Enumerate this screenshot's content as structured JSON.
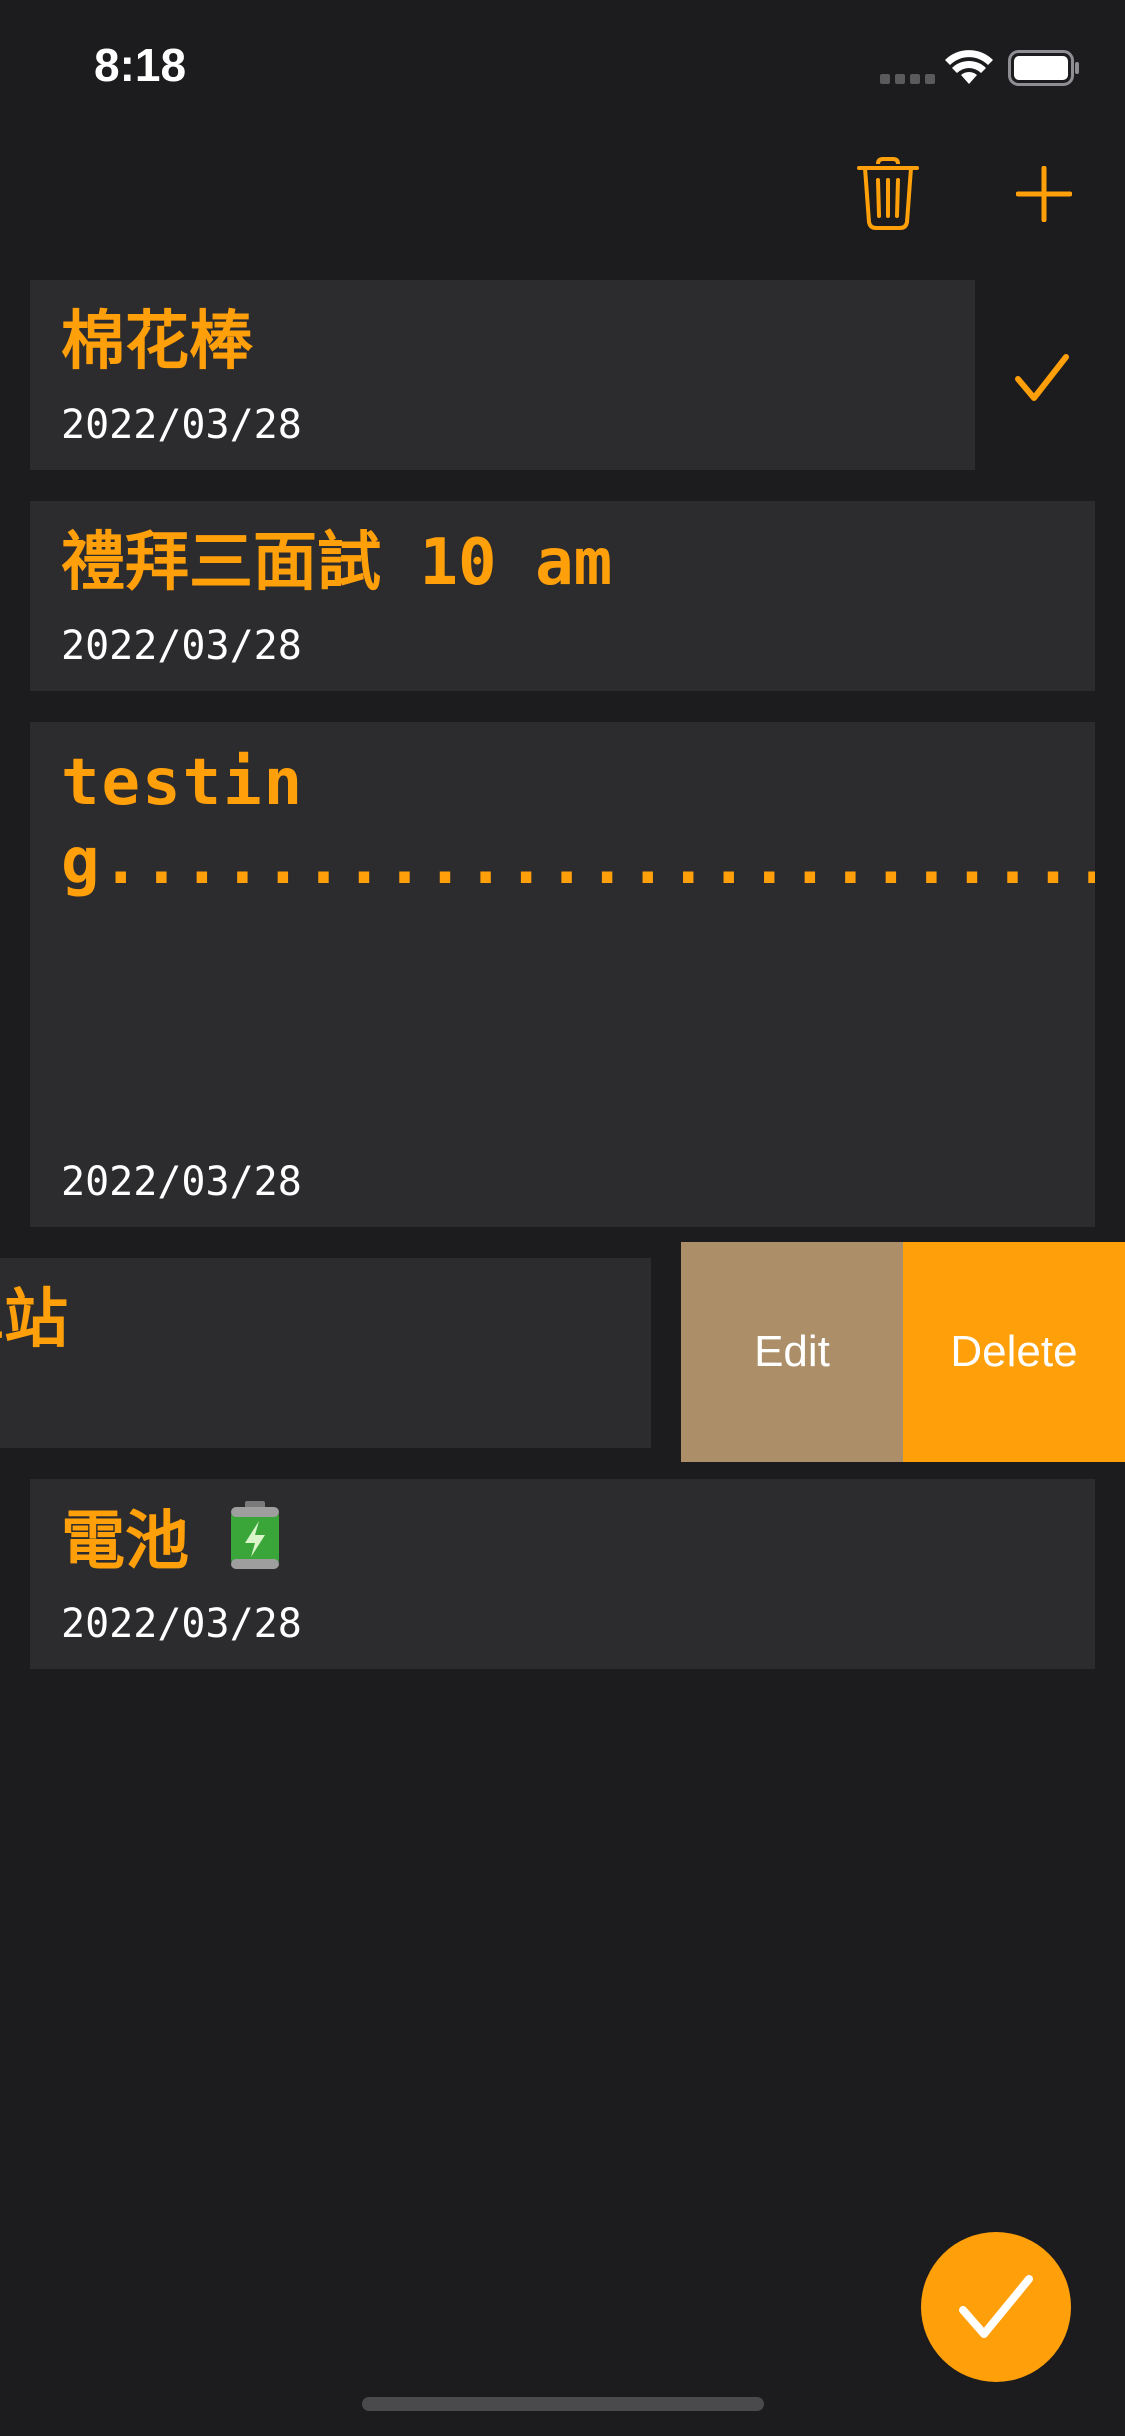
{
  "status_bar": {
    "time": "8:18"
  },
  "toolbar": {
    "trash_icon": "trash-icon",
    "add_icon": "plus-icon"
  },
  "todos": [
    {
      "title": "棉花棒",
      "date": "2022/03/28",
      "completed": true
    },
    {
      "title": "禮拜三面試 10 am",
      "date": "2022/03/28"
    },
    {
      "title": "testing..............................................................................................................",
      "date": "2022/03/28"
    },
    {
      "title_visible_fragment": "車站",
      "date": ""
    },
    {
      "title": "電池",
      "date": "2022/03/28",
      "emoji": "battery-icon"
    }
  ],
  "swipe_actions": {
    "edit_label": "Edit",
    "delete_label": "Delete"
  },
  "colors": {
    "accent": "#ff9f0a",
    "background": "#1c1c1e",
    "card": "#2c2c2e",
    "edit": "#ac8e68"
  }
}
